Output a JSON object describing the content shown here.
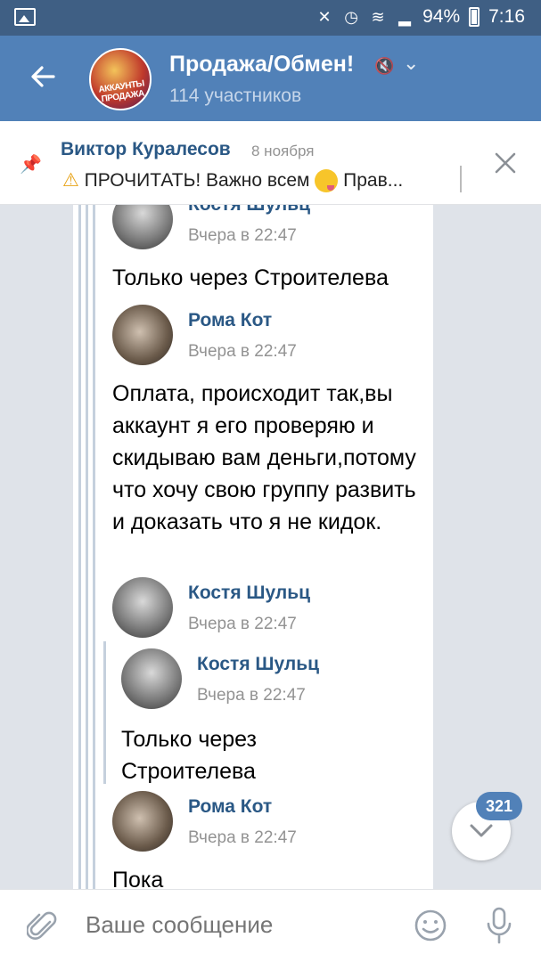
{
  "status_bar": {
    "battery": "94%",
    "time": "7:16"
  },
  "header": {
    "title": "Продажа/Обмен!",
    "subtitle": "114 участников",
    "avatar_text": "АККАУНТЫ ПРОДАЖА"
  },
  "pinned": {
    "author": "Виктор Куралесов",
    "date": "8 ноября",
    "text_prefix": "ПРОЧИТАТЬ! Важно всем",
    "text_suffix": "Прав..."
  },
  "messages": [
    {
      "author": "Костя Шульц",
      "time": "Вчера в 22:47",
      "text": "Только через Строителева"
    },
    {
      "author": "Рома Кот",
      "time": "Вчера в 22:47",
      "text": "Оплата, происходит так,вы аккаунт я его проверяю и скидываю вам деньги,потому что хочу свою группу развить и доказать что я не кидок."
    },
    {
      "author": "Костя Шульц",
      "time": "Вчера в 22:47"
    },
    {
      "author": "Костя Шульц",
      "time": "Вчера в 22:47",
      "text": "Только через Строителева"
    },
    {
      "author": "Рома Кот",
      "time": "Вчера в 22:47",
      "text": "Пока"
    }
  ],
  "unread_badge": "321",
  "composer": {
    "placeholder": "Ваше сообщение"
  },
  "colors": {
    "header": "#5181b8",
    "statusbar": "#3f5f84",
    "link": "#2a5885",
    "chat_bg": "#dfe3e9"
  },
  "icons": [
    "back-arrow-icon",
    "mute-icon",
    "chevron-down-icon",
    "pin-icon",
    "close-icon",
    "attach-icon",
    "smile-icon",
    "mic-icon"
  ]
}
